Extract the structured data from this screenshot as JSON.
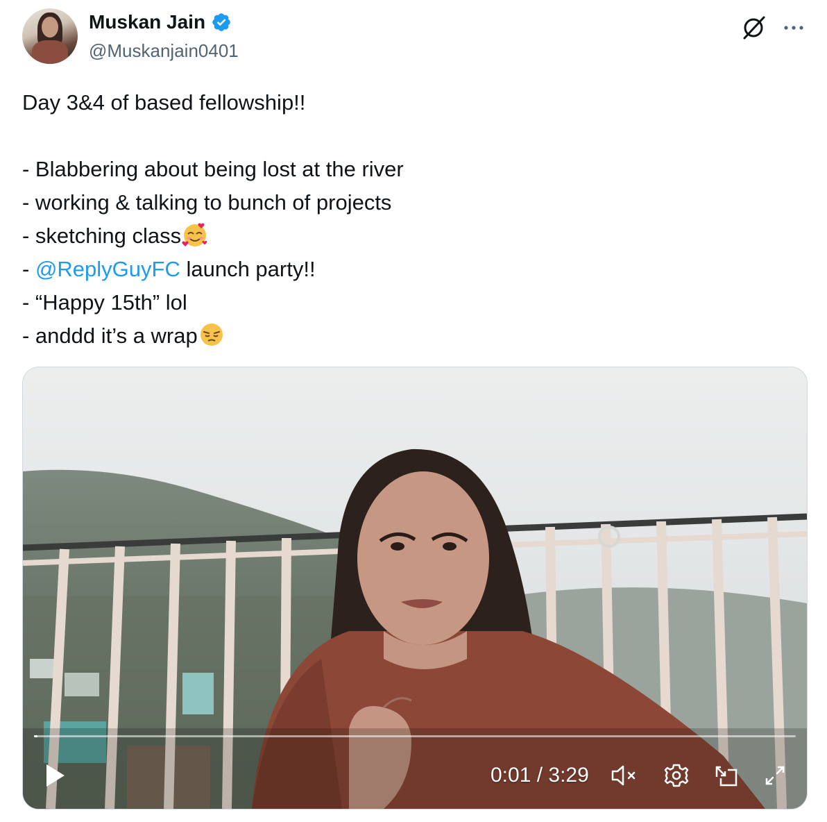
{
  "author": {
    "name": "Muskan Jain",
    "handle": "@Muskanjain0401",
    "verified": true,
    "verified_color": "#1d9bf0"
  },
  "header_icons": {
    "grok": "grok-icon",
    "more": "more-icon"
  },
  "tweet": {
    "line1": "Day 3&4 of based fellowship!!",
    "line2": "- Blabbering about being lost at the river",
    "line3": "- working & talking to bunch of projects",
    "line4": "- sketching class",
    "line4_emoji": "smiling-face-with-hearts-emoji",
    "line5_prefix": "- ",
    "line5_mention": "@ReplyGuyFC",
    "line5_suffix": " launch party!!",
    "line6": "- “Happy 15th” lol",
    "line7": "- anddd it’s a wrap",
    "line7_emoji": "pensive-face-emoji",
    "mention_color": "#1d9bf0"
  },
  "video": {
    "time_display": "0:01 / 3:29",
    "progress_fraction": 0.005,
    "controls": [
      "play-icon",
      "mute-icon",
      "settings-icon",
      "picture-in-picture-icon",
      "fullscreen-icon"
    ]
  }
}
